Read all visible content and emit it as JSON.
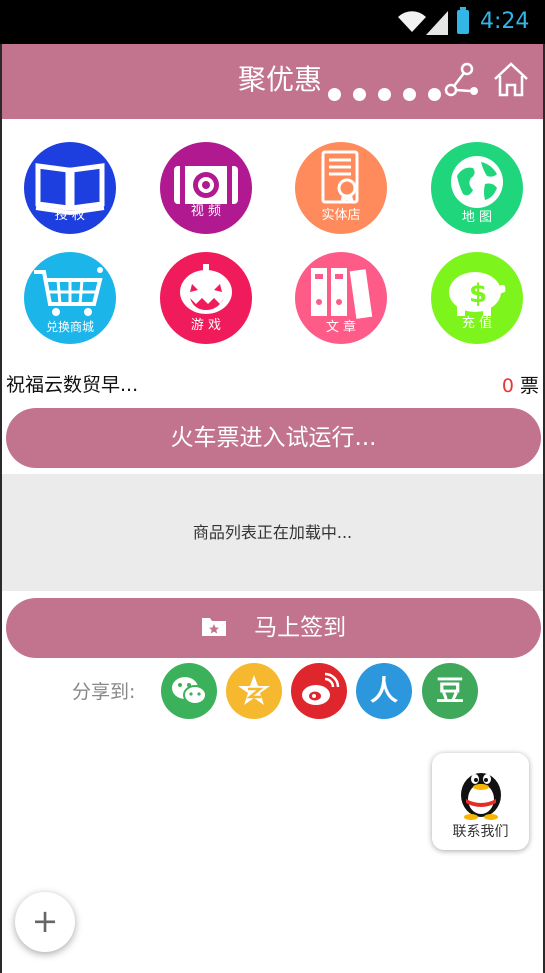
{
  "status_bar": {
    "time": "4:24",
    "icons": [
      "wifi-icon",
      "signal-icon",
      "battery-icon"
    ]
  },
  "header": {
    "title": "聚优惠",
    "background_color": "#c2748e",
    "icons": [
      "more-dots-icon",
      "share-icon",
      "home-icon"
    ]
  },
  "grid": [
    {
      "label": "授 权",
      "icon": "book-icon",
      "color": "#1e3fe0"
    },
    {
      "label": "视 频",
      "icon": "camera-icon",
      "color": "#b0198f"
    },
    {
      "label": "实体店",
      "icon": "certificate-icon",
      "color": "#ff8a5c"
    },
    {
      "label": "地 图",
      "icon": "globe-icon",
      "color": "#1fd67c"
    },
    {
      "label": "兑换商城",
      "icon": "shopping-cart-icon",
      "color": "#1cb5ea"
    },
    {
      "label": "游 戏",
      "icon": "pumpkin-icon",
      "color": "#ef1b5a"
    },
    {
      "label": "文 章",
      "icon": "binders-icon",
      "color": "#ff5b88"
    },
    {
      "label": "充 值",
      "icon": "piggy-bank-icon",
      "color": "#7df51c"
    }
  ],
  "ticket": {
    "headline": "祝福云数贸早...",
    "count": "0",
    "unit": "票"
  },
  "train_button": {
    "label": "火车票进入试运行..."
  },
  "product_list": {
    "loading_text": "商品列表正在加载中..."
  },
  "sign_button": {
    "label": "马上签到"
  },
  "share": {
    "label": "分享到:",
    "targets": [
      {
        "name": "wechat-icon",
        "glyph": "",
        "color": "#3cb15b"
      },
      {
        "name": "qzone-icon",
        "glyph": "",
        "color": "#f5b82e"
      },
      {
        "name": "weibo-icon",
        "glyph": "",
        "color": "#e0262d"
      },
      {
        "name": "renren-icon",
        "glyph": "人",
        "color": "#2c97dd"
      },
      {
        "name": "douban-icon",
        "glyph": "豆",
        "color": "#3fa85a"
      }
    ]
  },
  "contact": {
    "label": "联系我们"
  },
  "fab": {
    "label": "+"
  }
}
